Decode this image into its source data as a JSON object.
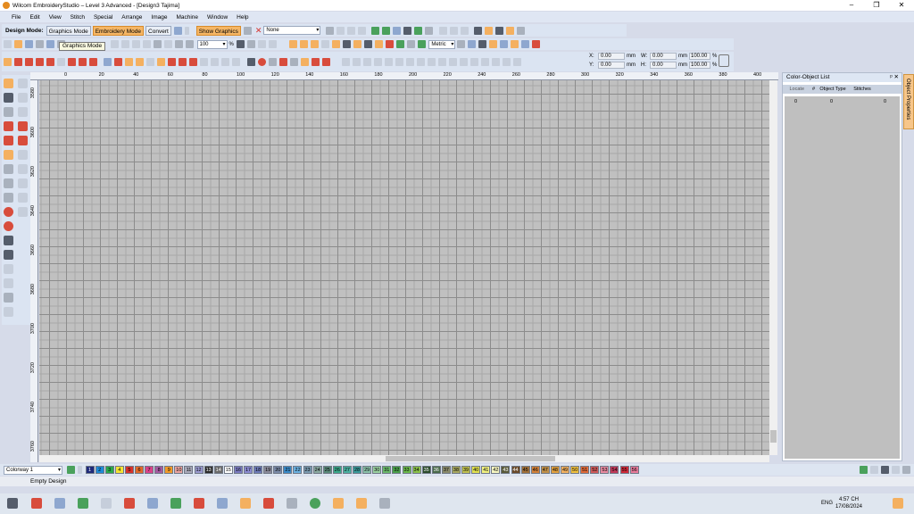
{
  "window": {
    "title": "Wilcom EmbroideryStudio – Level 3 Advanced - [Design3          Tajima]",
    "buttons": [
      "–",
      "❐",
      "✕"
    ]
  },
  "menu": [
    "File",
    "Edit",
    "View",
    "Stitch",
    "Special",
    "Arrange",
    "Image",
    "Machine",
    "Window",
    "Help"
  ],
  "toolbar1": {
    "design_mode_label": "Design Mode:",
    "graphics_mode": "Graphics Mode",
    "embroidery_mode": "Embroidery Mode",
    "convert": "Convert",
    "show_graphics": "Show Graphics",
    "fabric_value": "None",
    "units_value": "Metric"
  },
  "toolbar2": {
    "zoom_value": "100",
    "zoom_unit": "%",
    "tooltip": "Graphics Mode"
  },
  "toolbar3": {
    "x_label": "X:",
    "x_value": "0.00",
    "y_label": "Y:",
    "y_value": "0.00",
    "w_label": "W:",
    "w_value": "0.00",
    "h_label": "H:",
    "h_value": "0.00",
    "unit": "mm",
    "scale_w": "100.00",
    "scale_h": "100.00",
    "pct": "%"
  },
  "ruler_h_labels": [
    "0",
    "20",
    "40",
    "60",
    "80",
    "100",
    "120",
    "140",
    "160",
    "180",
    "200",
    "220",
    "240",
    "260",
    "280",
    "300",
    "320",
    "340",
    "360",
    "380",
    "400"
  ],
  "ruler_v_labels": [
    "3580",
    "3600",
    "3620",
    "3640",
    "3660",
    "3680",
    "3700",
    "3720",
    "3740",
    "3760"
  ],
  "panel": {
    "title": "Color-Object List",
    "header_buttons": "ᵖ  ✕",
    "columns": [
      "Locate",
      "#",
      "Object Type",
      "Stitches"
    ],
    "row": [
      "0",
      "0",
      "",
      "0"
    ],
    "side_tab": "Object Properties"
  },
  "palette": {
    "colorway": "Colorway 1",
    "swatches": [
      {
        "n": "1",
        "c": "#1f2a7a",
        "dark": true
      },
      {
        "n": "2",
        "c": "#1f8ad6",
        "dark": false
      },
      {
        "n": "3",
        "c": "#2aa84a",
        "dark": false
      },
      {
        "n": "4",
        "c": "#f5e234",
        "dark": false
      },
      {
        "n": "5",
        "c": "#d8322c",
        "dark": false
      },
      {
        "n": "6",
        "c": "#e06a2c",
        "dark": false
      },
      {
        "n": "7",
        "c": "#d8448a",
        "dark": false
      },
      {
        "n": "8",
        "c": "#a35aa0",
        "dark": false
      },
      {
        "n": "9",
        "c": "#f09a2a",
        "dark": false
      },
      {
        "n": "10",
        "c": "#e8a3a0",
        "dark": false
      },
      {
        "n": "11",
        "c": "#a8a8b8",
        "dark": false
      },
      {
        "n": "12",
        "c": "#9a9acf",
        "dark": false
      },
      {
        "n": "13",
        "c": "#2b2b2b",
        "dark": true
      },
      {
        "n": "14",
        "c": "#6a6a6a",
        "dark": true
      },
      {
        "n": "15",
        "c": "#ffffff",
        "dark": false
      },
      {
        "n": "16",
        "c": "#7a7ac0",
        "dark": false
      },
      {
        "n": "17",
        "c": "#8a8ad0",
        "dark": false
      },
      {
        "n": "18",
        "c": "#6d7ab8",
        "dark": false
      },
      {
        "n": "19",
        "c": "#8a8a9a",
        "dark": false
      },
      {
        "n": "20",
        "c": "#7a8aa8",
        "dark": false
      },
      {
        "n": "21",
        "c": "#3a8ac8",
        "dark": false
      },
      {
        "n": "22",
        "c": "#6ab0e0",
        "dark": false
      },
      {
        "n": "23",
        "c": "#7a9ab0",
        "dark": false
      },
      {
        "n": "24",
        "c": "#8aa8a0",
        "dark": false
      },
      {
        "n": "25",
        "c": "#5a8a7a",
        "dark": false
      },
      {
        "n": "26",
        "c": "#3aa88a",
        "dark": false
      },
      {
        "n": "27",
        "c": "#4ab0a0",
        "dark": false
      },
      {
        "n": "28",
        "c": "#3a9a9a",
        "dark": false
      },
      {
        "n": "29",
        "c": "#8ac0a8",
        "dark": false
      },
      {
        "n": "30",
        "c": "#9ad0a0",
        "dark": false
      },
      {
        "n": "31",
        "c": "#6ab86a",
        "dark": false
      },
      {
        "n": "32",
        "c": "#4aa04a",
        "dark": false
      },
      {
        "n": "33",
        "c": "#6ab84a",
        "dark": false
      },
      {
        "n": "34",
        "c": "#8ac04a",
        "dark": false
      },
      {
        "n": "35",
        "c": "#2a4a2a",
        "dark": true
      },
      {
        "n": "36",
        "c": "#4a6a4a",
        "dark": true
      },
      {
        "n": "37",
        "c": "#8a8a6a",
        "dark": false
      },
      {
        "n": "38",
        "c": "#a8a860",
        "dark": false
      },
      {
        "n": "39",
        "c": "#c0c050",
        "dark": false
      },
      {
        "n": "40",
        "c": "#e0e050",
        "dark": false
      },
      {
        "n": "41",
        "c": "#f0f080",
        "dark": false
      },
      {
        "n": "42",
        "c": "#f5f5c0",
        "dark": false
      },
      {
        "n": "43",
        "c": "#5a5a3a",
        "dark": true
      },
      {
        "n": "44",
        "c": "#6a4a2a",
        "dark": true
      },
      {
        "n": "45",
        "c": "#a0703a",
        "dark": false
      },
      {
        "n": "46",
        "c": "#d0803a",
        "dark": false
      },
      {
        "n": "47",
        "c": "#c0904a",
        "dark": false
      },
      {
        "n": "48",
        "c": "#e0a040",
        "dark": false
      },
      {
        "n": "49",
        "c": "#f0b060",
        "dark": false
      },
      {
        "n": "50",
        "c": "#f0c040",
        "dark": false
      },
      {
        "n": "51",
        "c": "#e06a3a",
        "dark": false
      },
      {
        "n": "52",
        "c": "#d05a5a",
        "dark": false
      },
      {
        "n": "53",
        "c": "#e88aa0",
        "dark": false
      },
      {
        "n": "54",
        "c": "#c03a5a",
        "dark": false
      },
      {
        "n": "55",
        "c": "#d02a3a",
        "dark": false
      },
      {
        "n": "56",
        "c": "#e87a9a",
        "dark": false
      }
    ]
  },
  "status": {
    "text": "Empty Design"
  },
  "taskbar": {
    "time": "4:57 CH",
    "date": "17/08/2024",
    "lang": "ENG"
  }
}
